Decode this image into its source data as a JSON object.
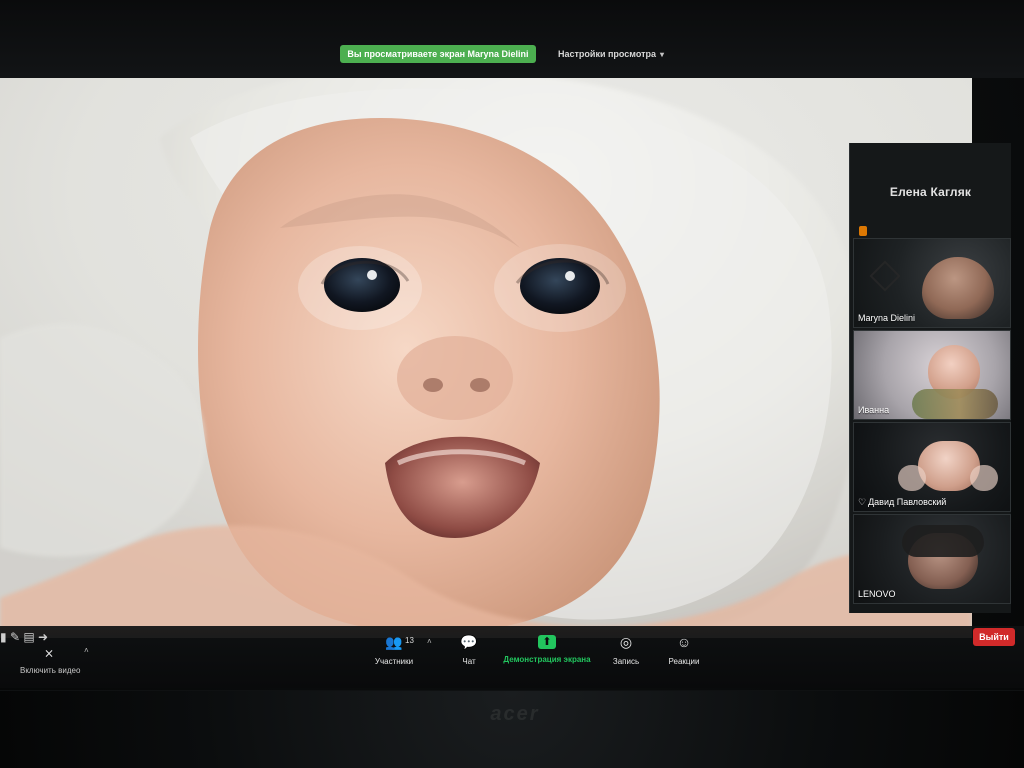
{
  "top": {
    "sharing_status": "Вы просматриваете экран Maryna Dielini",
    "view_settings": "Настройки просмотра",
    "view_settings_icon": "chevron-down-icon"
  },
  "panel": {
    "active_speaker": "Елена Кагляк",
    "tiles": [
      {
        "name": "Maryna Dielini"
      },
      {
        "name": "Иванна"
      },
      {
        "name": "Давид Павловский",
        "icon": "heart-icon"
      },
      {
        "name": "LENOVO"
      }
    ]
  },
  "toolbar": {
    "participants": {
      "label": "Участники",
      "count": "13",
      "icon": "users-icon"
    },
    "chat": {
      "label": "Чат",
      "icon": "chat-bubble-icon"
    },
    "share_screen": {
      "label": "Демонстрация экрана",
      "icon": "share-screen-icon",
      "accent": "#22c55e"
    },
    "record": {
      "label": "Запись",
      "icon": "record-icon"
    },
    "reactions": {
      "label": "Реакции",
      "icon": "emoji-icon"
    },
    "leave": {
      "label": "Выйти",
      "accent": "#d12a2a"
    },
    "video": {
      "label": "Включить видео",
      "icon": "video-off-icon"
    }
  },
  "branding": {
    "device_label": "acer"
  },
  "colors": {
    "sharing_badge_bg": "#4caf50",
    "panel_bg": "#151819",
    "toolbar_bg": "#0f1112"
  }
}
